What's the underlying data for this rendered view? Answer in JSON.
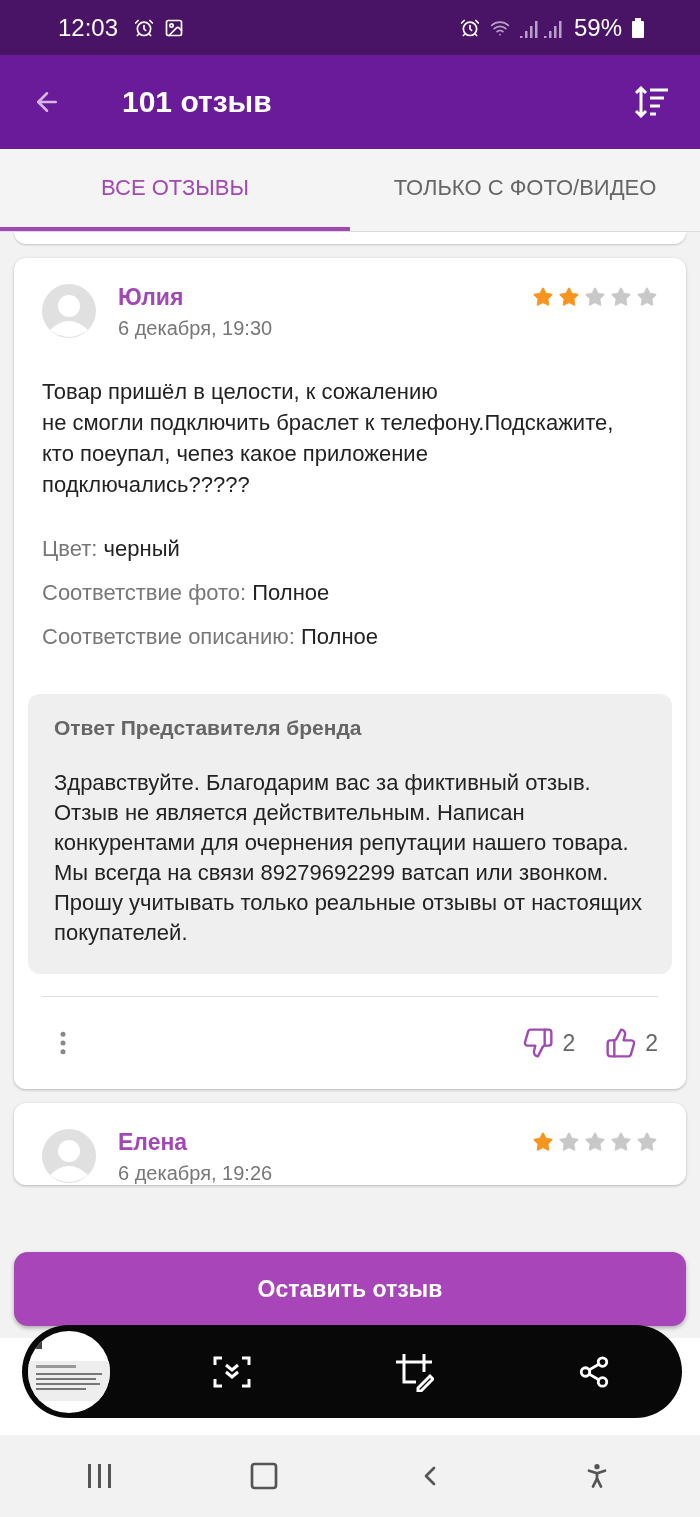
{
  "status_bar": {
    "time": "12:03",
    "battery": "59%"
  },
  "header": {
    "title": "101 отзыв"
  },
  "tabs": [
    {
      "label": "ВСЕ ОТЗЫВЫ",
      "selected": true
    },
    {
      "label": "ТОЛЬКО С ФОТО/ВИДЕО",
      "selected": false
    }
  ],
  "reviews": [
    {
      "author": "Юлия",
      "date": "6 декабря, 19:30",
      "stars": 2,
      "text": "Товар пришёл в целости, к сожалению\nне смогли подключить браслет к телефону.Подскажите, кто поеупал, чепез какое приложение подключались?????",
      "attributes": [
        {
          "label": "Цвет:",
          "value": "черный"
        },
        {
          "label": "Соответствие фото:",
          "value": "Полное"
        },
        {
          "label": "Соответствие описанию:",
          "value": "Полное"
        }
      ],
      "reply": {
        "title": "Ответ Представителя бренда",
        "text": "Здравствуйте. Благодарим вас за фиктивный отзыв. Отзыв не является действительным. Написан конкурентами для очернения репутации нашего товара. Мы всегда на связи 89279692299 ватсап или звонком. Прошу учитывать только реальные отзывы от настоящих покупателей."
      },
      "dislikes": "2",
      "likes": "2"
    },
    {
      "author": "Елена",
      "date": "6 декабря, 19:26",
      "stars": 1
    }
  ],
  "action_button": "Оставить отзыв"
}
